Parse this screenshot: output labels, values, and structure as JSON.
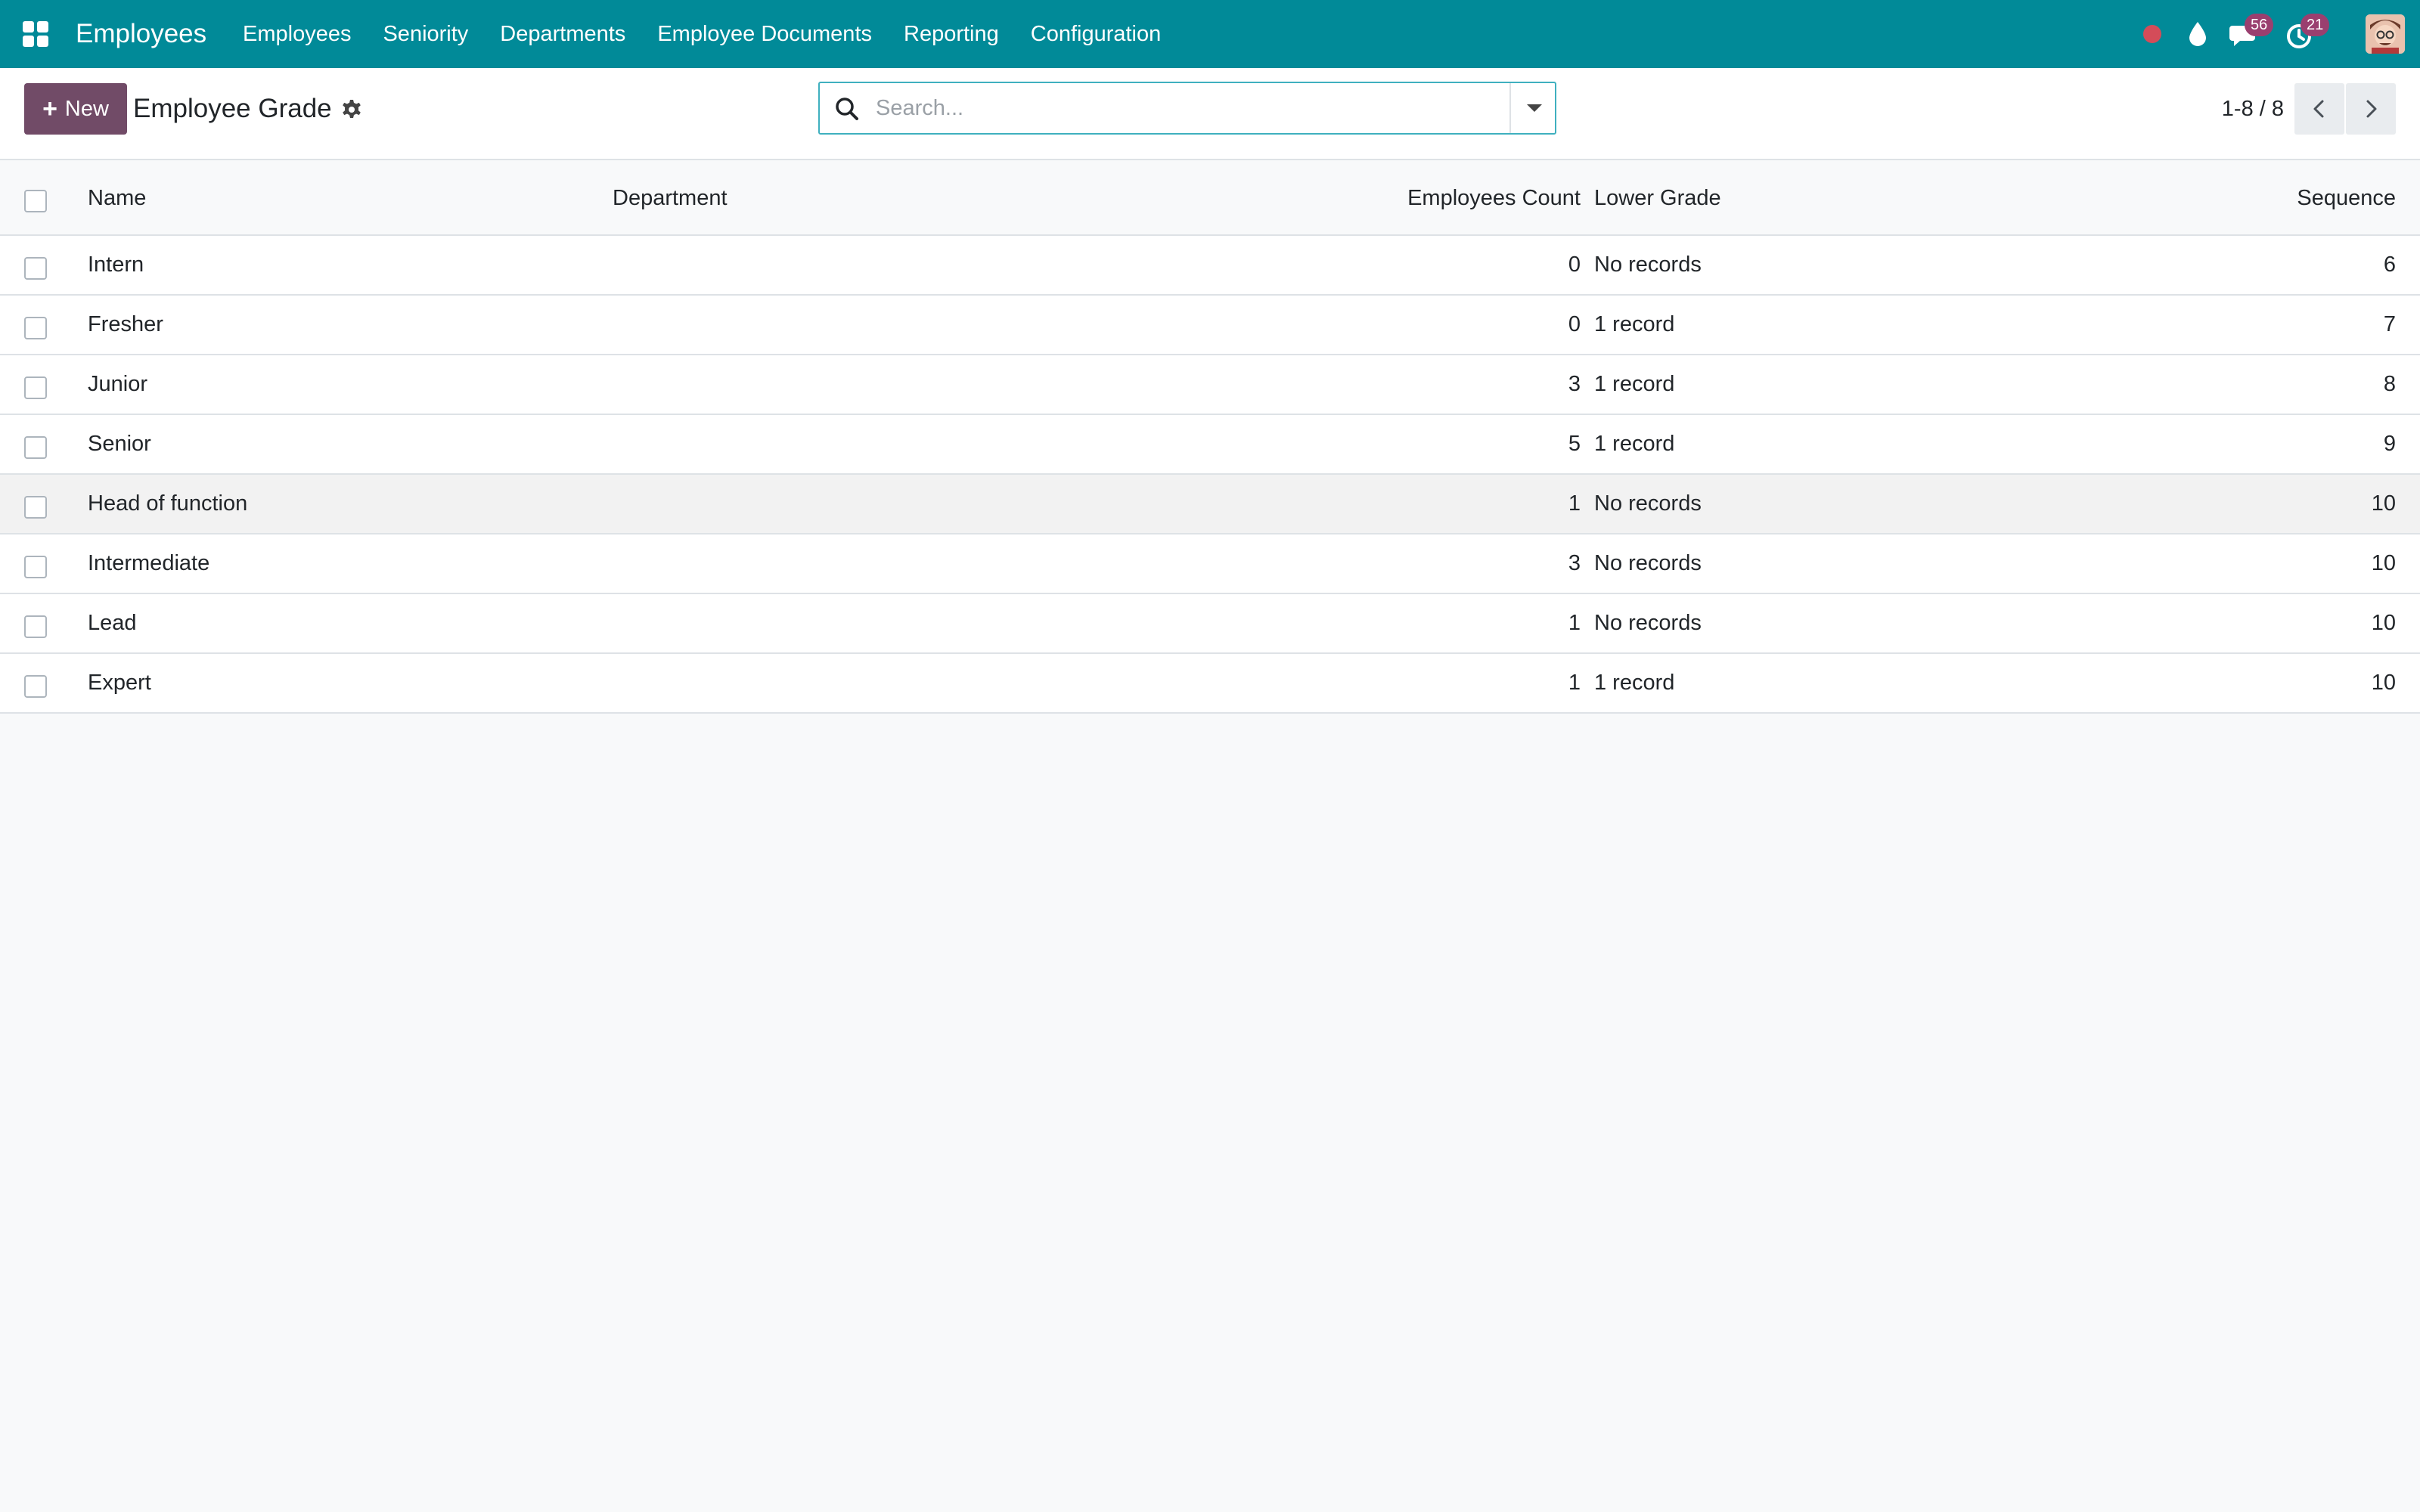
{
  "navbar": {
    "app_title": "Employees",
    "menu": [
      "Employees",
      "Seniority",
      "Departments",
      "Employee Documents",
      "Reporting",
      "Configuration"
    ],
    "chat_count": "56",
    "activity_count": "21",
    "icons": [
      "apps-grid-icon",
      "record-dot-icon",
      "drop-icon",
      "chat-icon",
      "activity-clock-icon",
      "user-avatar"
    ],
    "colors": {
      "bar": "#018a98",
      "badge": "#9a3f6f",
      "record": "#d44c59"
    }
  },
  "control_panel": {
    "new_label": "New",
    "breadcrumb": "Employee Grade",
    "search_placeholder": "Search...",
    "pager": "1-8 / 8",
    "colors": {
      "new_button": "#714b67",
      "search_border": "#3fb0bf"
    }
  },
  "list": {
    "columns": [
      "Name",
      "Department",
      "Employees Count",
      "Lower Grade",
      "Sequence"
    ],
    "rows": [
      {
        "name": "Intern",
        "department": "",
        "count": "0",
        "lower_grade": "No records",
        "sequence": "6"
      },
      {
        "name": "Fresher",
        "department": "",
        "count": "0",
        "lower_grade": "1 record",
        "sequence": "7"
      },
      {
        "name": "Junior",
        "department": "",
        "count": "3",
        "lower_grade": "1 record",
        "sequence": "8"
      },
      {
        "name": "Senior",
        "department": "",
        "count": "5",
        "lower_grade": "1 record",
        "sequence": "9"
      },
      {
        "name": "Head of function",
        "department": "",
        "count": "1",
        "lower_grade": "No records",
        "sequence": "10"
      },
      {
        "name": "Intermediate",
        "department": "",
        "count": "3",
        "lower_grade": "No records",
        "sequence": "10"
      },
      {
        "name": "Lead",
        "department": "",
        "count": "1",
        "lower_grade": "No records",
        "sequence": "10"
      },
      {
        "name": "Expert",
        "department": "",
        "count": "1",
        "lower_grade": "1 record",
        "sequence": "10"
      }
    ]
  }
}
